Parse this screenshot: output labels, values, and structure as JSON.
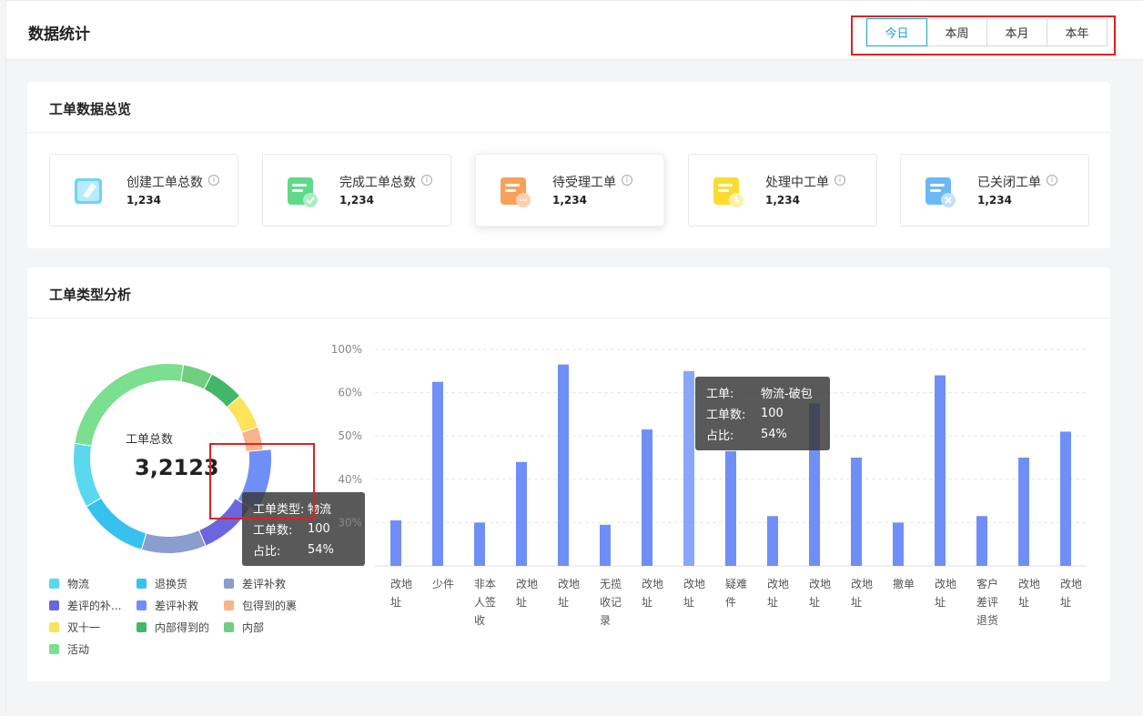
{
  "header": {
    "title": "数据统计",
    "ranges": [
      "今日",
      "本周",
      "本月",
      "本年"
    ],
    "active_range": "今日"
  },
  "overview": {
    "title": "工单数据总览",
    "stats": [
      {
        "label": "创建工单总数",
        "value": "1,234",
        "icon": "tickets-created-icon"
      },
      {
        "label": "完成工单总数",
        "value": "1,234",
        "icon": "tickets-done-icon"
      },
      {
        "label": "待受理工单",
        "value": "1,234",
        "icon": "tickets-pending-icon"
      },
      {
        "label": "处理中工单",
        "value": "1,234",
        "icon": "tickets-processing-icon"
      },
      {
        "label": "已关闭工单",
        "value": "1,234",
        "icon": "tickets-closed-icon"
      }
    ],
    "info_glyph": "i"
  },
  "analysis": {
    "title": "工单类型分析",
    "donut_label": "工单总数",
    "donut_value": "3,2123",
    "donut_tooltip": {
      "type_key": "工单类型:",
      "type_val": "物流",
      "count_key": "工单数:",
      "count_val": "100",
      "ratio_key": "占比:",
      "ratio_val": "54%"
    },
    "bar_tooltip": {
      "type_key": "工单:",
      "type_val": "物流-破包",
      "count_key": "工单数:",
      "count_val": "100",
      "ratio_key": "占比:",
      "ratio_val": "54%"
    }
  },
  "colors": {
    "accent": "#18a4c9",
    "bar": "#6f8ff7",
    "bar_highlight": "#8aa6f9",
    "red_highlight": "#e02020"
  },
  "chart_data": [
    {
      "type": "pie",
      "variant": "donut",
      "categories": [
        "物流",
        "退换货",
        "差评补救",
        "差评的补...",
        "差评补救",
        "包得到的裹",
        "双十一",
        "内部得到的",
        "内部",
        "活动"
      ],
      "values": [
        11,
        12,
        11,
        10,
        10,
        4,
        6,
        6,
        5,
        25
      ],
      "colors": [
        "#5ad8f0",
        "#36c2ef",
        "#8b9dcf",
        "#6b66df",
        "#6f8ff7",
        "#f8b48a",
        "#fde35a",
        "#43b768",
        "#6fcf7f",
        "#7ae08f"
      ],
      "highlighted": "差评补救",
      "title": "工单总数"
    },
    {
      "type": "bar",
      "categories": [
        "改地址",
        "少件",
        "非本人签收",
        "改地址",
        "改地址",
        "无揽收记录",
        "改地址",
        "改地址",
        "疑难件",
        "改地址",
        "改地址",
        "改地址",
        "撤单",
        "改地址",
        "客户差评退货",
        "改地址",
        "改地址"
      ],
      "category_lines": [
        [
          "改地",
          "址"
        ],
        [
          "少件"
        ],
        [
          "非本",
          "人签",
          "收"
        ],
        [
          "改地",
          "址"
        ],
        [
          "改地",
          "址"
        ],
        [
          "无揽",
          "收记",
          "录"
        ],
        [
          "改地",
          "址"
        ],
        [
          "改地",
          "址"
        ],
        [
          "疑难",
          "件"
        ],
        [
          "改地",
          "址"
        ],
        [
          "改地",
          "址"
        ],
        [
          "改地",
          "址"
        ],
        [
          "撤单"
        ],
        [
          "改地",
          "址"
        ],
        [
          "客户",
          "差评",
          "退货"
        ],
        [
          "改地",
          "址"
        ],
        [
          "改地",
          "址"
        ]
      ],
      "y_ticks": [
        "100%",
        "60%",
        "50%",
        "40%",
        "30%"
      ],
      "values": [
        0.21,
        0.85,
        0.2,
        0.48,
        0.93,
        0.19,
        0.63,
        0.9,
        0.53,
        0.23,
        0.75,
        0.5,
        0.2,
        0.88,
        0.23,
        0.5,
        0.62
      ],
      "highlighted_index": 7,
      "grid": true
    }
  ]
}
